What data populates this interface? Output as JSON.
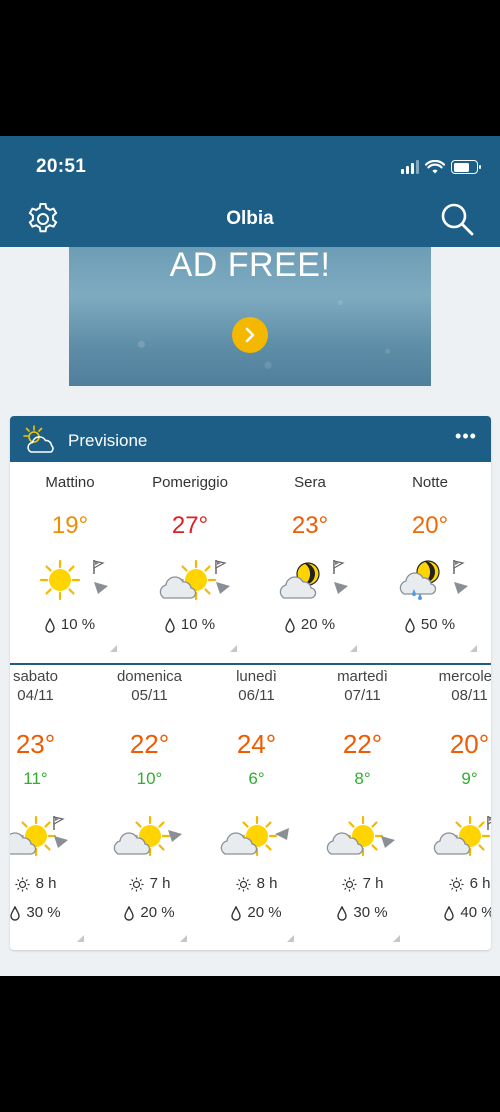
{
  "status_bar": {
    "time": "20:51"
  },
  "header": {
    "title": "Olbia"
  },
  "ad": {
    "text": "AD FREE!"
  },
  "forecast": {
    "title": "Previsione",
    "more": "•••",
    "day_parts": [
      {
        "label": "Mattino",
        "temp": "19°",
        "temp_color": "#f08c00",
        "icon": "sun-icon",
        "rain": "10 %"
      },
      {
        "label": "Pomeriggio",
        "temp": "27°",
        "temp_color": "#e02020",
        "icon": "sun-cloud-icon",
        "rain": "10 %"
      },
      {
        "label": "Sera",
        "temp": "23°",
        "temp_color": "#f05a00",
        "icon": "moon-cloud-icon",
        "rain": "20 %"
      },
      {
        "label": "Notte",
        "temp": "20°",
        "temp_color": "#f06a00",
        "icon": "moon-cloud-rain-icon",
        "rain": "50 %"
      }
    ],
    "days": [
      {
        "name": "sabato",
        "date": "04/11",
        "max": "23°",
        "min": "11°",
        "icon": "sun-cloud-icon",
        "sun": "8 h",
        "rain": "30 %"
      },
      {
        "name": "domenica",
        "date": "05/11",
        "max": "22°",
        "min": "10°",
        "icon": "sun-cloud-icon",
        "sun": "7 h",
        "rain": "20 %"
      },
      {
        "name": "lunedì",
        "date": "06/11",
        "max": "24°",
        "min": "6°",
        "icon": "sun-cloud-icon",
        "sun": "8 h",
        "rain": "20 %"
      },
      {
        "name": "martedì",
        "date": "07/11",
        "max": "22°",
        "min": "8°",
        "icon": "sun-cloud-icon",
        "sun": "7 h",
        "rain": "30 %"
      },
      {
        "name": "mercoled",
        "date": "08/11",
        "max": "20°",
        "min": "9°",
        "icon": "sun-cloud-icon",
        "sun": "6 h",
        "rain": "40 %"
      }
    ],
    "max_temp_color": "#f05a00",
    "min_temp_color": "#2fae2f"
  },
  "colors": {
    "header": "#1c5e86",
    "ad_button": "#f5b800",
    "sun": "#ffd400"
  }
}
